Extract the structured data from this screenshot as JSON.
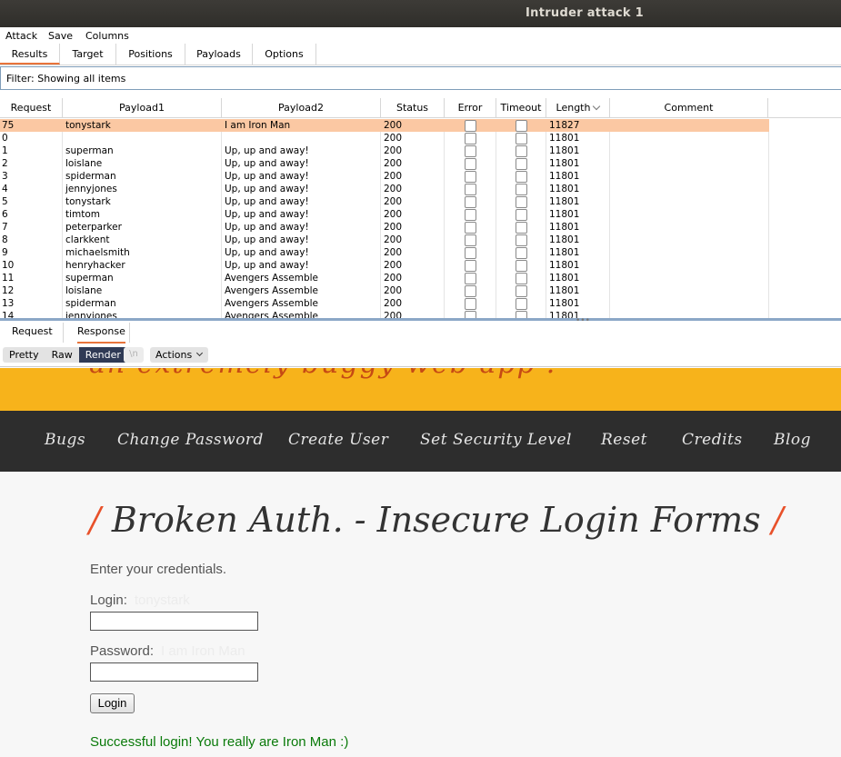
{
  "window": {
    "title": "Intruder attack 1"
  },
  "menu": {
    "attack": "Attack",
    "save": "Save",
    "columns": "Columns"
  },
  "tabs": {
    "results": "Results",
    "target": "Target",
    "positions": "Positions",
    "payloads": "Payloads",
    "options": "Options"
  },
  "filter": {
    "text": "Filter:  Showing all items"
  },
  "table": {
    "headers": {
      "request": "Request",
      "payload1": "Payload1",
      "payload2": "Payload2",
      "status": "Status",
      "error": "Error",
      "timeout": "Timeout",
      "length": "Length",
      "comment": "Comment"
    },
    "rows": [
      {
        "request": "75",
        "payload1": "tonystark",
        "payload2": "I am Iron Man",
        "status": "200",
        "length": "11827"
      },
      {
        "request": "0",
        "payload1": "",
        "payload2": "",
        "status": "200",
        "length": "11801"
      },
      {
        "request": "1",
        "payload1": "superman",
        "payload2": "Up, up and away!",
        "status": "200",
        "length": "11801"
      },
      {
        "request": "2",
        "payload1": "loislane",
        "payload2": "Up, up and away!",
        "status": "200",
        "length": "11801"
      },
      {
        "request": "3",
        "payload1": "spiderman",
        "payload2": "Up, up and away!",
        "status": "200",
        "length": "11801"
      },
      {
        "request": "4",
        "payload1": "jennyjones",
        "payload2": "Up, up and away!",
        "status": "200",
        "length": "11801"
      },
      {
        "request": "5",
        "payload1": "tonystark",
        "payload2": "Up, up and away!",
        "status": "200",
        "length": "11801"
      },
      {
        "request": "6",
        "payload1": "timtom",
        "payload2": "Up, up and away!",
        "status": "200",
        "length": "11801"
      },
      {
        "request": "7",
        "payload1": "peterparker",
        "payload2": "Up, up and away!",
        "status": "200",
        "length": "11801"
      },
      {
        "request": "8",
        "payload1": "clarkkent",
        "payload2": "Up, up and away!",
        "status": "200",
        "length": "11801"
      },
      {
        "request": "9",
        "payload1": "michaelsmith",
        "payload2": "Up, up and away!",
        "status": "200",
        "length": "11801"
      },
      {
        "request": "10",
        "payload1": "henryhacker",
        "payload2": "Up, up and away!",
        "status": "200",
        "length": "11801"
      },
      {
        "request": "11",
        "payload1": "superman",
        "payload2": "Avengers Assemble",
        "status": "200",
        "length": "11801"
      },
      {
        "request": "12",
        "payload1": "loislane",
        "payload2": "Avengers Assemble",
        "status": "200",
        "length": "11801"
      },
      {
        "request": "13",
        "payload1": "spiderman",
        "payload2": "Avengers Assemble",
        "status": "200",
        "length": "11801"
      },
      {
        "request": "14",
        "payload1": "jennyjones",
        "payload2": "Avengers Assemble",
        "status": "200",
        "length": "11801"
      }
    ]
  },
  "reqresp": {
    "request": "Request",
    "response": "Response"
  },
  "toolbar": {
    "pretty": "Pretty",
    "raw": "Raw",
    "render": "Render",
    "newline": "\\n",
    "actions": "Actions"
  },
  "page": {
    "banner": "an extremely buggy web app !",
    "nav": [
      "Bugs",
      "Change Password",
      "Create User",
      "Set Security Level",
      "Reset",
      "Credits",
      "Blog"
    ],
    "heading": "Broken Auth. - Insecure Login Forms",
    "slash": "/",
    "intro": "Enter your credentials.",
    "login_label": "Login:",
    "login_hint": "tonystark",
    "password_label": "Password:",
    "password_hint": "I am Iron Man",
    "login_button": "Login",
    "success": "Successful login! You really are Iron Man :)",
    "colors": {
      "banner": "#f7b31b",
      "nav": "#2d2d2d",
      "accent": "#e8512a",
      "success": "#0a7a0a"
    }
  }
}
